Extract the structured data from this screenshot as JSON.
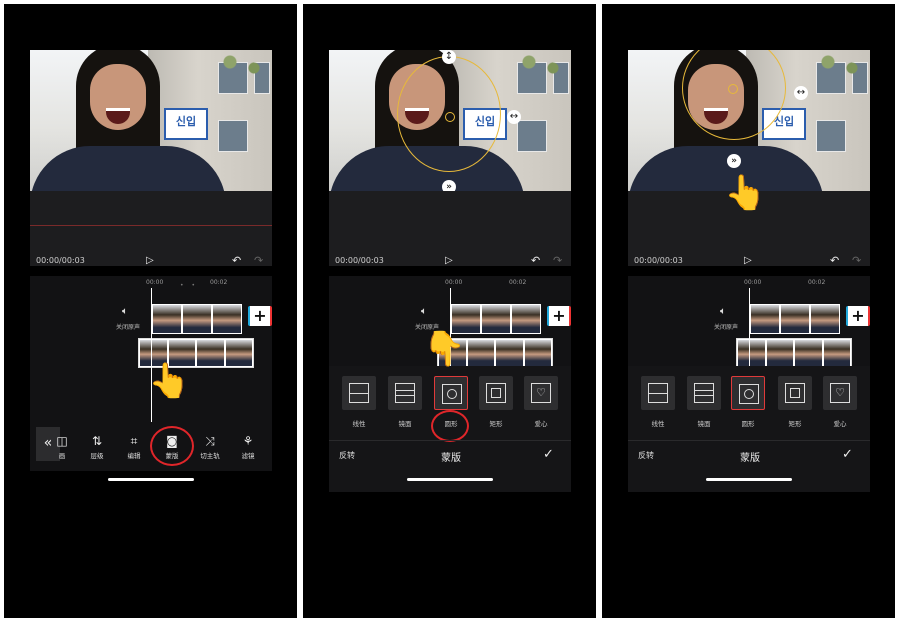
{
  "player": {
    "time": "00:00/00:03",
    "play_icon": "play-icon",
    "undo_icon": "undo-icon",
    "redo_icon": "redo-icon"
  },
  "video": {
    "sign_text": "신입"
  },
  "timeline": {
    "tick_0": "00:00",
    "tick_2": "00:02",
    "audio_label": "关闭原声",
    "add_label": "+"
  },
  "toolbar": {
    "items": [
      {
        "label": "画",
        "icon": "animation-icon"
      },
      {
        "label": "层级",
        "icon": "layer-icon"
      },
      {
        "label": "编辑",
        "icon": "crop-icon"
      },
      {
        "label": "蒙版",
        "icon": "mask-icon"
      },
      {
        "label": "切主轨",
        "icon": "shuffle-icon"
      },
      {
        "label": "滤镜",
        "icon": "filter-icon"
      }
    ],
    "collapse_label": "«"
  },
  "mask_panel": {
    "options": [
      {
        "label": "线性"
      },
      {
        "label": "镜面"
      },
      {
        "label": "圆形"
      },
      {
        "label": "矩形"
      },
      {
        "label": "爱心"
      }
    ],
    "selected": "圆形",
    "invert_label": "反转",
    "title": "蒙版",
    "confirm_icon": "checkmark-icon"
  },
  "colors": {
    "accent_ring": "#e0262a",
    "mask_outline": "#e7b93a",
    "background": "#000000"
  }
}
